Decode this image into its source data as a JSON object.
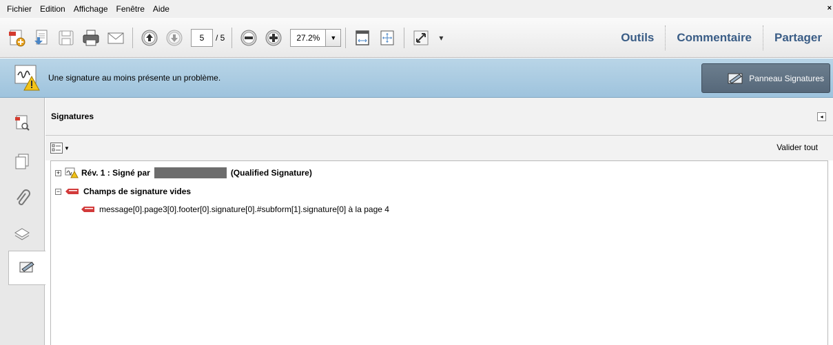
{
  "menu": {
    "items": [
      "Fichier",
      "Edition",
      "Affichage",
      "Fenêtre",
      "Aide"
    ],
    "close_glyph": "×"
  },
  "toolbar": {
    "page_current": "5",
    "page_total": "/ 5",
    "zoom": "27.2%",
    "tabs": [
      "Outils",
      "Commentaire",
      "Partager"
    ],
    "icons": [
      "create-pdf-icon",
      "export-icon",
      "save-icon",
      "print-icon",
      "email-icon",
      "previous-page-icon",
      "next-page-icon",
      "zoom-out-icon",
      "zoom-in-icon",
      "fit-page-icon",
      "fit-width-icon",
      "full-screen-icon"
    ]
  },
  "infobar": {
    "message": "Une signature au moins présente un problème.",
    "panel_button": "Panneau Signatures"
  },
  "panel": {
    "title": "Signatures",
    "validate_all": "Valider tout",
    "tree": {
      "rev_label": "Rév. 1 : Signé par",
      "rev_suffix": "(Qualified Signature)",
      "empty_fields_label": "Champs de signature vides",
      "field_entry": "message[0].page3[0].footer[0].signature[0].#subform[1].signature[0] à la page 4"
    }
  },
  "colors": {
    "accent": "#3a5d86",
    "infobar": "#a9cbe2",
    "signature_field": "#d23a3a"
  }
}
